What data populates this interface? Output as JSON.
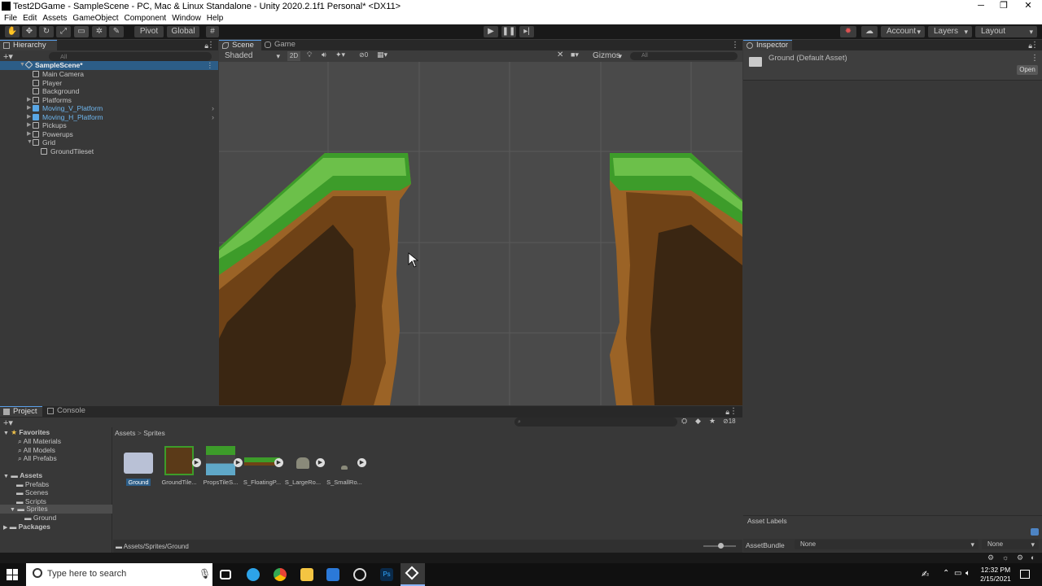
{
  "window": {
    "title": "Test2DGame - SampleScene - PC, Mac & Linux Standalone - Unity 2020.2.1f1 Personal* <DX11>"
  },
  "menu": [
    "File",
    "Edit",
    "Assets",
    "GameObject",
    "Component",
    "Window",
    "Help"
  ],
  "toolbar": {
    "pivot": "Pivot",
    "global": "Global",
    "account": "Account",
    "layers": "Layers",
    "layout": "Layout"
  },
  "hierarchy": {
    "tab": "Hierarchy",
    "search_placeholder": "All",
    "scene": "SampleScene*",
    "items": [
      "Main Camera",
      "Player",
      "Background",
      "Platforms",
      "Moving_V_Platform",
      "Moving_H_Platform",
      "Pickups",
      "Powerups",
      "Grid",
      "GroundTileset"
    ]
  },
  "scene": {
    "tab_scene": "Scene",
    "tab_game": "Game",
    "shading": "Shaded",
    "mode_2d": "2D",
    "hidden_count": "0",
    "gizmos": "Gizmos",
    "search_placeholder": "All"
  },
  "inspector": {
    "tab": "Inspector",
    "asset_name": "Ground (Default Asset)",
    "open": "Open",
    "asset_labels": "Asset Labels",
    "assetbundle_label": "AssetBundle",
    "assetbundle_value": "None",
    "variant_value": "None"
  },
  "project": {
    "tab_project": "Project",
    "tab_console": "Console",
    "count": "18",
    "favorites": {
      "label": "Favorites",
      "items": [
        "All Materials",
        "All Models",
        "All Prefabs"
      ]
    },
    "assets": {
      "label": "Assets",
      "items": [
        "Prefabs",
        "Scenes",
        "Scripts",
        "Sprites",
        "Ground"
      ]
    },
    "packages": "Packages",
    "breadcrumb": [
      "Assets",
      "Sprites"
    ],
    "files": [
      "Ground",
      "GroundTile...",
      "PropsTileS...",
      "S_FloatingP...",
      "S_LargeRo...",
      "S_SmallRo..."
    ],
    "path": "Assets/Sprites/Ground"
  },
  "taskbar": {
    "search_placeholder": "Type here to search",
    "time": "12:32 PM",
    "date": "2/15/2021"
  }
}
